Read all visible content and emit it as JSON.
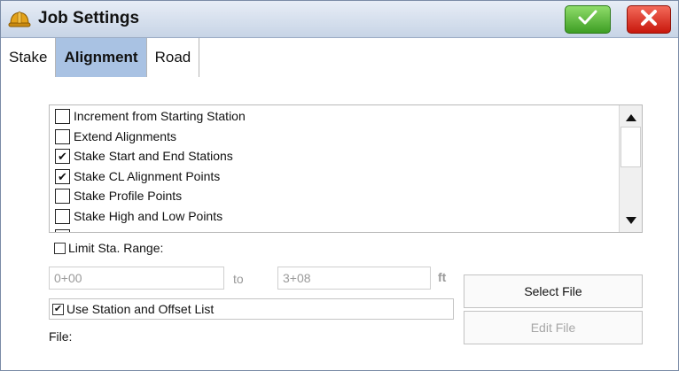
{
  "window": {
    "title": "Job Settings",
    "icon": "hard-hat-icon",
    "ok_icon": "checkmark-icon",
    "cancel_icon": "close-icon",
    "ok_color": "#3e9e24",
    "cancel_color": "#c8170c"
  },
  "tabs": [
    {
      "label": "Stake",
      "active": false
    },
    {
      "label": "Alignment",
      "active": true
    },
    {
      "label": "Road",
      "active": false
    }
  ],
  "options": [
    {
      "label": "Increment from Starting Station",
      "checked": false
    },
    {
      "label": "Extend Alignments",
      "checked": false
    },
    {
      "label": "Stake Start and End Stations",
      "checked": true
    },
    {
      "label": "Stake CL Alignment Points",
      "checked": true
    },
    {
      "label": "Stake Profile Points",
      "checked": false
    },
    {
      "label": "Stake High and Low Points",
      "checked": false
    }
  ],
  "limit_range": {
    "label": "Limit Sta. Range:",
    "checked": false,
    "from_value": "0+00",
    "to_label": "to",
    "to_value": "3+08",
    "unit": "ft"
  },
  "station_offset": {
    "label": "Use Station and Offset List",
    "checked": true
  },
  "file": {
    "label": "File:"
  },
  "buttons": {
    "select_file": "Select File",
    "edit_file": "Edit File"
  }
}
